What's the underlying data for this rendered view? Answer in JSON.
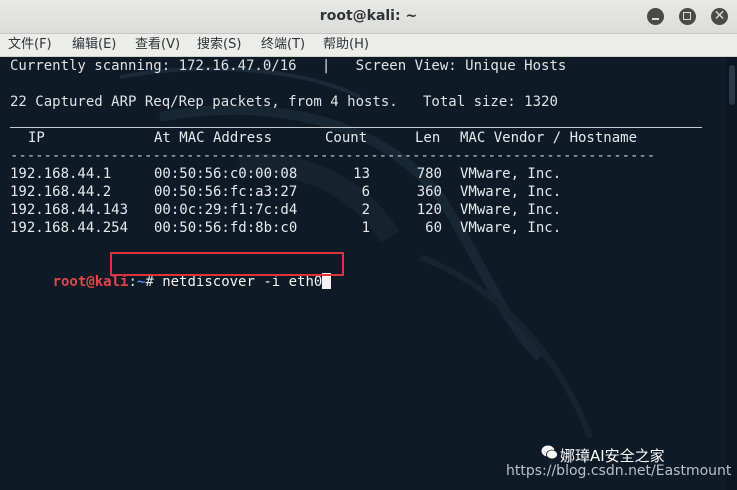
{
  "window": {
    "title": "root@kali: ~"
  },
  "menu": [
    "文件(F)",
    "编辑(E)",
    "查看(V)",
    "搜索(S)",
    "终端(T)",
    "帮助(H)"
  ],
  "terminal": {
    "line1": "Currently scanning: 172.16.47.0/16   |   Screen View: Unique Hosts",
    "line2": "22 Captured ARP Req/Rep packets, from 4 hosts.   Total size: 1320",
    "header": {
      "ip": "IP",
      "mac": "At MAC Address",
      "count": "Count",
      "len": "Len",
      "vendor": "MAC Vendor / Hostname"
    },
    "dashes": "-----------------------------------------------------------------------------",
    "rows": [
      {
        "ip": "192.168.44.1",
        "mac": "00:50:56:c0:00:08",
        "count": "13",
        "len": "780",
        "vendor": "VMware, Inc."
      },
      {
        "ip": "192.168.44.2",
        "mac": "00:50:56:fc:a3:27",
        "count": "6",
        "len": "360",
        "vendor": "VMware, Inc."
      },
      {
        "ip": "192.168.44.143",
        "mac": "00:0c:29:f1:7c:d4",
        "count": "2",
        "len": "120",
        "vendor": "VMware, Inc."
      },
      {
        "ip": "192.168.44.254",
        "mac": "00:50:56:fd:8b:c0",
        "count": "1",
        "len": "60",
        "vendor": "VMware, Inc."
      }
    ],
    "prompt": {
      "user": "root@kali",
      "sep": ":",
      "path": "~",
      "symbol": "#",
      "command": "netdiscover -i eth0"
    }
  },
  "watermark": {
    "brand": "娜璋AI安全之家",
    "url": "https://blog.csdn.net/Eastmount"
  },
  "colors": {
    "highlight_box": "#e0303a",
    "prompt_user": "#e0464b",
    "prompt_path": "#4f8fe0"
  }
}
